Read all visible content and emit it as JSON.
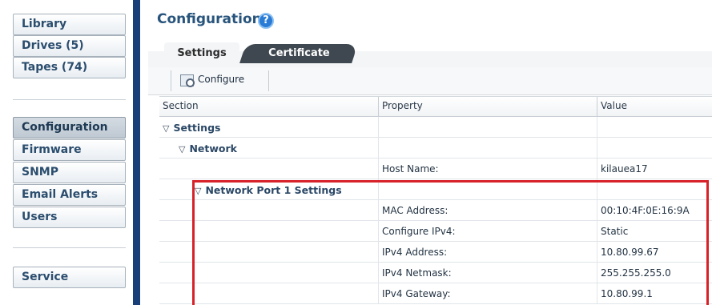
{
  "nav": {
    "items_top": [
      "Library",
      "Drives (5)",
      "Tapes (74)"
    ],
    "items_mid": [
      "Configuration",
      "Firmware",
      "SNMP",
      "Email Alerts",
      "Users"
    ],
    "items_bottom": [
      "Service"
    ],
    "selected": "Configuration"
  },
  "page": {
    "title": "Configuration",
    "help_glyph": "?"
  },
  "tabs": [
    "Settings",
    "Certificate"
  ],
  "toolbar": {
    "configure_label": "Configure"
  },
  "table": {
    "headers": [
      "Section",
      "Property",
      "Value"
    ],
    "rows": [
      {
        "section": "Settings",
        "property": "",
        "value": "",
        "expanded": true,
        "level": 0
      },
      {
        "section": "Network",
        "property": "",
        "value": "",
        "expanded": true,
        "level": 1
      },
      {
        "section": "",
        "property": "Host Name:",
        "value": "kilauea17",
        "level": 2
      },
      {
        "section": "Network Port 1 Settings",
        "property": "",
        "value": "",
        "expanded": true,
        "level": 2
      },
      {
        "section": "",
        "property": "MAC Address:",
        "value": "00:10:4F:0E:16:9A",
        "level": 3
      },
      {
        "section": "",
        "property": "Configure IPv4:",
        "value": "Static",
        "level": 3
      },
      {
        "section": "",
        "property": "IPv4 Address:",
        "value": "10.80.99.67",
        "level": 3
      },
      {
        "section": "",
        "property": "IPv4 Netmask:",
        "value": "255.255.255.0",
        "level": 3
      },
      {
        "section": "",
        "property": "IPv4 Gateway:",
        "value": "10.80.99.1",
        "level": 3
      }
    ]
  },
  "colors": {
    "nav_border": "#193f78",
    "title": "#28547c",
    "highlight": "#d7222a"
  }
}
